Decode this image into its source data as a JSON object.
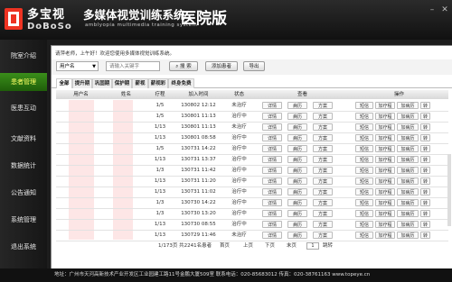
{
  "header": {
    "logo_cn": "多宝视",
    "logo_en": "DoBoSo",
    "system_title": "多媒体视觉训练系统",
    "system_subtitle": "amblyopia multimedia training system",
    "hospital_label": "医院版",
    "window_controls": [
      "minimize-icon",
      "close-icon"
    ]
  },
  "sidebar": {
    "items": [
      {
        "label": "院室介绍",
        "active": false
      },
      {
        "label": "患者管理",
        "active": true
      },
      {
        "label": "医患互动",
        "active": false
      },
      {
        "label": "文献资料",
        "active": false
      },
      {
        "label": "数据统计",
        "active": false
      },
      {
        "label": "公告通知",
        "active": false
      },
      {
        "label": "系统管理",
        "active": false
      },
      {
        "label": "退出系统",
        "active": false
      }
    ]
  },
  "main": {
    "greeting": "请萍老师，上午好！欢迎您使用多媒体视觉训练系统。",
    "toolbar": {
      "filter_select": "用户名",
      "search_placeholder": "请输入关键字",
      "search_button": "搜 索",
      "add_button": "添加患者",
      "export_button": "导出"
    },
    "tabs": [
      {
        "label": "全部",
        "active": true
      },
      {
        "label": "提升期",
        "active": false
      },
      {
        "label": "巩固期",
        "active": false
      },
      {
        "label": "保护期",
        "active": false
      },
      {
        "label": "薪视",
        "active": false
      },
      {
        "label": "薪视彩",
        "active": false
      },
      {
        "label": "终身免费",
        "active": false
      }
    ],
    "columns": [
      "用户名",
      "姓名",
      "疗程",
      "加入时间",
      "状态",
      "查看",
      "操作"
    ],
    "view_buttons": [
      "详情",
      "病历",
      "方案"
    ],
    "action_buttons": [
      "短信",
      "加疗程",
      "加病历",
      "转"
    ],
    "rows": [
      {
        "course": "1/5",
        "time": "130802 12:12",
        "status": "未治疗"
      },
      {
        "course": "1/5",
        "time": "130801 11:13",
        "status": "治疗中"
      },
      {
        "course": "1/13",
        "time": "130801 11:13",
        "status": "未治疗"
      },
      {
        "course": "1/13",
        "time": "130801 08:58",
        "status": "治疗中"
      },
      {
        "course": "1/5",
        "time": "130731 14:22",
        "status": "治疗中"
      },
      {
        "course": "1/13",
        "time": "130731 13:37",
        "status": "治疗中"
      },
      {
        "course": "1/3",
        "time": "130731 11:42",
        "status": "治疗中"
      },
      {
        "course": "1/13",
        "time": "130731 11:20",
        "status": "治疗中"
      },
      {
        "course": "1/13",
        "time": "130731 11:02",
        "status": "治疗中"
      },
      {
        "course": "1/3",
        "time": "130730 14:22",
        "status": "治疗中"
      },
      {
        "course": "1/3",
        "time": "130730 13:20",
        "status": "治疗中"
      },
      {
        "course": "1/13",
        "time": "130730 08:55",
        "status": "治疗中"
      },
      {
        "course": "1/13",
        "time": "130729 11:46",
        "status": "未治疗"
      }
    ],
    "pager": {
      "info": "1/173页  共2241名患者",
      "first": "首页",
      "prev": "上页",
      "next": "下页",
      "last": "末页",
      "page_value": "1",
      "jump": "跳转"
    }
  },
  "footer": {
    "text": "地址：广州市天河高新技术产业开发区工业园建工路11号金鹏大厦509室      联系电话：020-85683012     传真：020-38761163     www.topeye.cn"
  },
  "colors": {
    "active_side": "#3a8e1a",
    "header_bg": "#111111",
    "redacted": "#fde6e6"
  }
}
